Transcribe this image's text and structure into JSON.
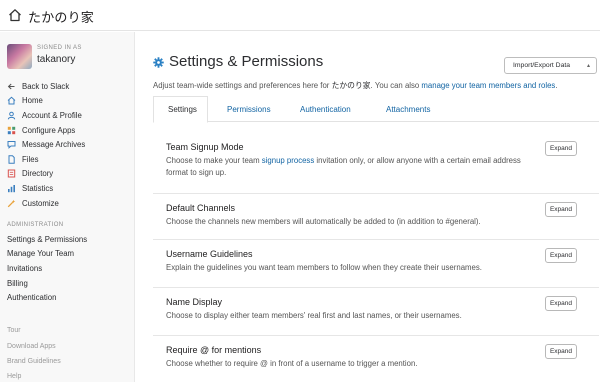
{
  "topbar": {
    "team_name": "たかのり家"
  },
  "user": {
    "signed_in_label": "SIGNED IN AS",
    "name": "takanory"
  },
  "sidebar": {
    "items": [
      {
        "label": "Back to Slack",
        "icon": "arrow-left-icon"
      },
      {
        "label": "Home",
        "icon": "home-icon"
      },
      {
        "label": "Account & Profile",
        "icon": "person-icon"
      },
      {
        "label": "Configure Apps",
        "icon": "apps-icon"
      },
      {
        "label": "Message Archives",
        "icon": "chat-icon"
      },
      {
        "label": "Files",
        "icon": "file-icon"
      },
      {
        "label": "Directory",
        "icon": "directory-icon"
      },
      {
        "label": "Statistics",
        "icon": "stats-icon"
      },
      {
        "label": "Customize",
        "icon": "customize-icon"
      }
    ],
    "admin_heading": "ADMINISTRATION",
    "admin_items": [
      "Settings & Permissions",
      "Manage Your Team",
      "Invitations",
      "Billing",
      "Authentication"
    ],
    "footer_items": [
      "Tour",
      "Download Apps",
      "Brand Guidelines",
      "Help"
    ]
  },
  "main": {
    "title": "Settings & Permissions",
    "export_button": "Import/Export Data",
    "description_prefix": "Adjust team-wide settings and preferences here for ",
    "description_team": "たかのり家",
    "description_middle": ". You can also ",
    "description_link": "manage your team members and roles",
    "description_suffix": ".",
    "tabs": [
      "Settings",
      "Permissions",
      "Authentication",
      "Attachments"
    ],
    "sections": [
      {
        "title": "Team Signup Mode",
        "desc_before": "Choose to make your team ",
        "desc_link": "signup process",
        "desc_after": " invitation only, or allow anyone with a certain email address format to sign up.",
        "button": "Expand"
      },
      {
        "title": "Default Channels",
        "desc_before": "Choose the channels new members will automatically be added to (in addition to #general).",
        "desc_link": "",
        "desc_after": "",
        "button": "Expand"
      },
      {
        "title": "Username Guidelines",
        "desc_before": "Explain the guidelines you want team members to follow when they create their usernames.",
        "desc_link": "",
        "desc_after": "",
        "button": "Expand"
      },
      {
        "title": "Name Display",
        "desc_before": "Choose to display either team members' real first and last names, or their usernames.",
        "desc_link": "",
        "desc_after": "",
        "button": "Expand"
      },
      {
        "title": "Require @ for mentions",
        "desc_before": "Choose whether to require @ in front of a username to trigger a mention.",
        "desc_link": "",
        "desc_after": "",
        "button": "Expand"
      }
    ]
  },
  "colors": {
    "link": "#1264a3",
    "accent_gear": "#2a80c4",
    "sidebar_bg": "#f8f8f8"
  }
}
